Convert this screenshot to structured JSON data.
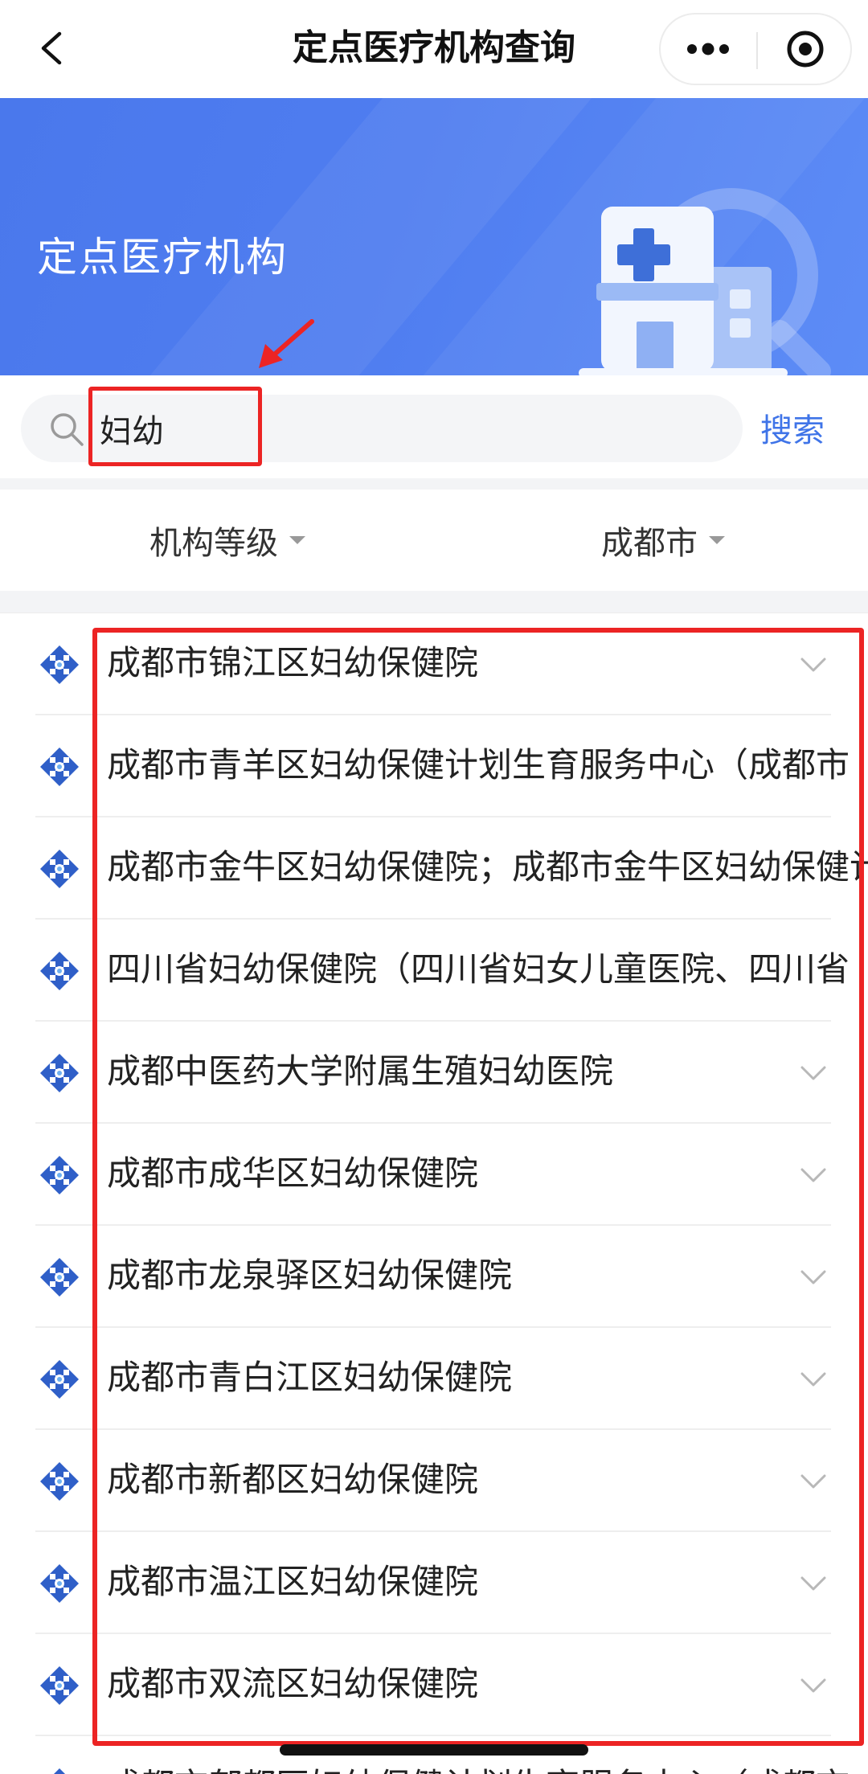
{
  "navbar": {
    "title": "定点医疗机构查询",
    "back_icon": "chevron-left-icon",
    "more_icon": "more-dots-icon",
    "close_icon": "target-circle-icon"
  },
  "banner": {
    "title": "定点医疗机构",
    "illustration": "hospital-building-icon"
  },
  "search": {
    "value": "妇幼",
    "button_label": "搜索",
    "icon": "search-icon"
  },
  "filters": {
    "level_label": "机构等级",
    "city_label": "成都市"
  },
  "results": [
    {
      "name": "成都市锦江区妇幼保健院",
      "expandable": true
    },
    {
      "name": "成都市青羊区妇幼保健计划生育服务中心（成都市",
      "expandable": false
    },
    {
      "name": "成都市金牛区妇幼保健院；成都市金牛区妇幼保健计",
      "expandable": false
    },
    {
      "name": "四川省妇幼保健院（四川省妇女儿童医院、四川省",
      "expandable": false
    },
    {
      "name": "成都中医药大学附属生殖妇幼医院",
      "expandable": true
    },
    {
      "name": "成都市成华区妇幼保健院",
      "expandable": true
    },
    {
      "name": "成都市龙泉驿区妇幼保健院",
      "expandable": true
    },
    {
      "name": "成都市青白江区妇幼保健院",
      "expandable": true
    },
    {
      "name": "成都市新都区妇幼保健院",
      "expandable": true
    },
    {
      "name": "成都市温江区妇幼保健院",
      "expandable": true
    },
    {
      "name": "成都市双流区妇幼保健院",
      "expandable": true
    },
    {
      "name": "成都市郫都区妇幼保健计划生育服务中心（成都市",
      "expandable": false
    }
  ],
  "colors": {
    "brand_blue": "#4f7df0",
    "link_blue": "#3f74e8",
    "annotation_red": "#ec2424"
  }
}
